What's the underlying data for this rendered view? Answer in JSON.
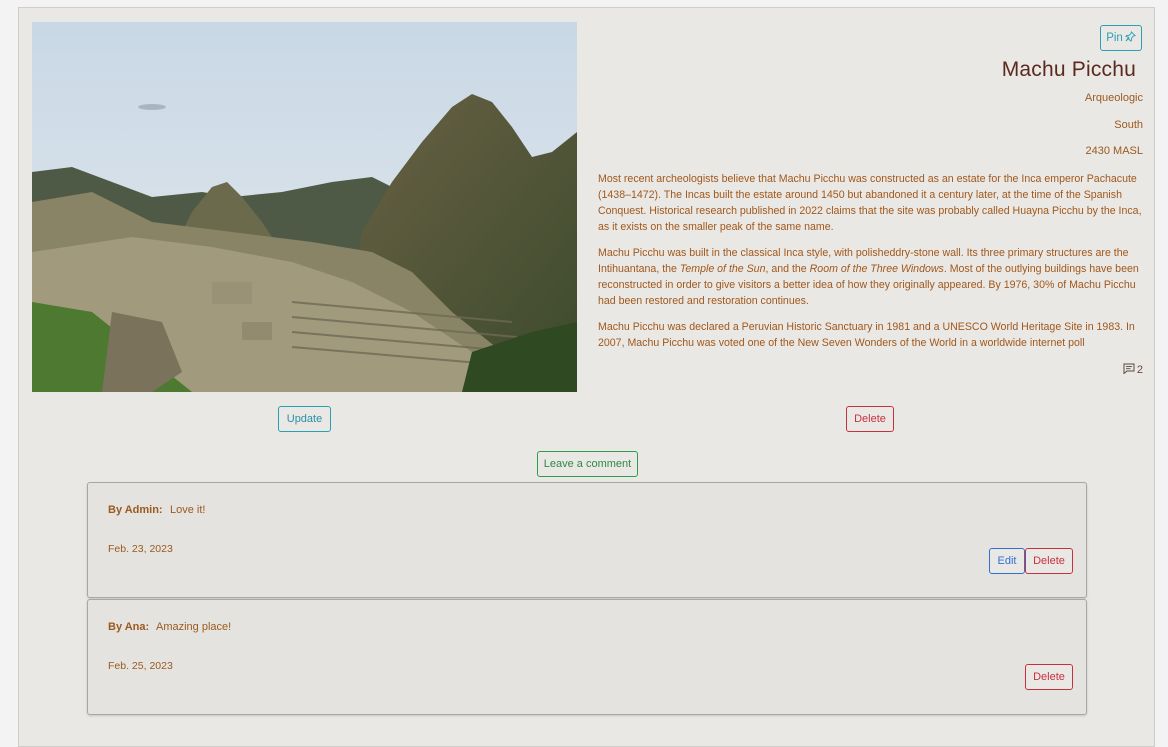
{
  "place": {
    "pin_label": "Pin",
    "title": "Machu Picchu",
    "type": "Arqueologic",
    "region": "South",
    "altitude": "2430 MASL",
    "description": {
      "p1": "Most recent archeologists believe that Machu Picchu was constructed as an estate for the Inca emperor Pachacute (1438–1472). The Incas built the estate around 1450 but abandoned it a century later, at the time of the Spanish Conquest.  Historical research published in 2022 claims that the site was probably called Huayna Picchu by the Inca, as it exists on the smaller peak of the same name.",
      "p2_a": "Machu Picchu was built in the classical Inca style, with polisheddry-stone wall. Its three primary structures are the Intihuantana, the ",
      "p2_em1": "Temple of the Sun",
      "p2_b": ", and the ",
      "p2_em2": "Room of the Three Windows",
      "p2_c": ". Most of the outlying buildings have been reconstructed in order to give visitors a better idea of how they originally appeared. By 1976, 30% of Machu Picchu had been restored and restoration continues.",
      "p3": "Machu Picchu was declared a Peruvian Historic Sanctuary in 1981 and a UNESCO World Heritage Site in 1983. In 2007, Machu Picchu was voted one of the New Seven Wonders of the World in a worldwide internet poll"
    },
    "comment_count": "2"
  },
  "actions": {
    "update_label": "Update",
    "delete_label": "Delete",
    "leave_comment_label": "Leave a comment"
  },
  "comments": [
    {
      "author": "By Admin:",
      "text": "Love it!",
      "date": "Feb. 23, 2023",
      "edit_label": "Edit",
      "delete_label": "Delete"
    },
    {
      "author": "By Ana:",
      "text": "Amazing place!",
      "date": "Feb. 25, 2023",
      "delete_label": "Delete"
    }
  ],
  "icons": {
    "pin": "pin-icon",
    "comments": "comment-icon"
  },
  "colors": {
    "text_brown": "#a0581c",
    "title": "#5a2a1e",
    "info": "#2aa0b4",
    "danger": "#c9303e",
    "success": "#2e9e4a",
    "primary": "#2f6fd6"
  }
}
